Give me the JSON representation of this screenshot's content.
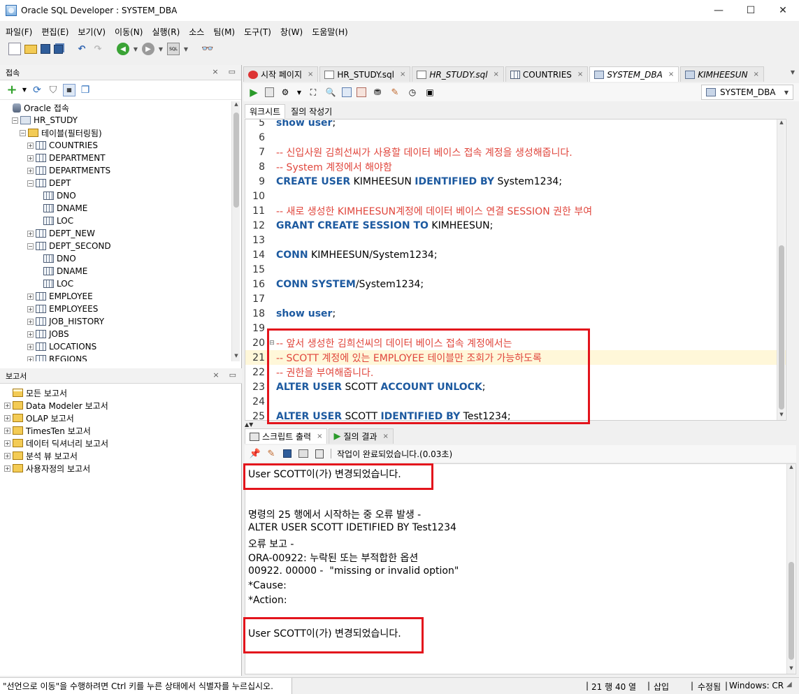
{
  "window": {
    "title": "Oracle SQL Developer : SYSTEM_DBA",
    "controls": {
      "minimize": "—",
      "maximize": "☐",
      "close": "✕"
    }
  },
  "menu": [
    "파일(F)",
    "편집(E)",
    "보기(V)",
    "이동(N)",
    "실행(R)",
    "소스",
    "팀(M)",
    "도구(T)",
    "창(W)",
    "도움말(H)"
  ],
  "connections_panel": {
    "title": "접속",
    "tree": [
      {
        "label": "Oracle 접속",
        "icon": "database-icon",
        "level": 0,
        "toggle": ""
      },
      {
        "label": "HR_STUDY",
        "icon": "connection-icon",
        "level": 1,
        "toggle": "-"
      },
      {
        "label": "테이블(필터링됨)",
        "icon": "folder-icon",
        "level": 2,
        "toggle": "-"
      },
      {
        "label": "COUNTRIES",
        "icon": "table-icon",
        "level": 3,
        "toggle": "+"
      },
      {
        "label": "DEPARTMENT",
        "icon": "table-icon",
        "level": 3,
        "toggle": "+"
      },
      {
        "label": "DEPARTMENTS",
        "icon": "table-icon",
        "level": 3,
        "toggle": "+"
      },
      {
        "label": "DEPT",
        "icon": "table-icon",
        "level": 3,
        "toggle": "-"
      },
      {
        "label": "DNO",
        "icon": "column-icon",
        "level": 4,
        "toggle": ""
      },
      {
        "label": "DNAME",
        "icon": "column-icon",
        "level": 4,
        "toggle": ""
      },
      {
        "label": "LOC",
        "icon": "column-icon",
        "level": 4,
        "toggle": ""
      },
      {
        "label": "DEPT_NEW",
        "icon": "table-icon",
        "level": 3,
        "toggle": "+"
      },
      {
        "label": "DEPT_SECOND",
        "icon": "table-icon",
        "level": 3,
        "toggle": "-"
      },
      {
        "label": "DNO",
        "icon": "column-icon",
        "level": 4,
        "toggle": ""
      },
      {
        "label": "DNAME",
        "icon": "column-icon",
        "level": 4,
        "toggle": ""
      },
      {
        "label": "LOC",
        "icon": "column-icon",
        "level": 4,
        "toggle": ""
      },
      {
        "label": "EMPLOYEE",
        "icon": "table-icon",
        "level": 3,
        "toggle": "+"
      },
      {
        "label": "EMPLOYEES",
        "icon": "table-icon",
        "level": 3,
        "toggle": "+"
      },
      {
        "label": "JOB_HISTORY",
        "icon": "table-icon",
        "level": 3,
        "toggle": "+"
      },
      {
        "label": "JOBS",
        "icon": "table-icon",
        "level": 3,
        "toggle": "+"
      },
      {
        "label": "LOCATIONS",
        "icon": "table-icon",
        "level": 3,
        "toggle": "+"
      },
      {
        "label": "REGIONS",
        "icon": "table-icon",
        "level": 3,
        "toggle": "+"
      }
    ]
  },
  "reports_panel": {
    "title": "보고서",
    "tree": [
      {
        "label": "모든 보고서",
        "icon": "reports-root-icon",
        "level": 0,
        "toggle": ""
      },
      {
        "label": "Data Modeler 보고서",
        "icon": "report-folder-icon",
        "level": 1,
        "toggle": "+"
      },
      {
        "label": "OLAP 보고서",
        "icon": "report-folder-icon",
        "level": 1,
        "toggle": "+"
      },
      {
        "label": "TimesTen 보고서",
        "icon": "report-folder-icon",
        "level": 1,
        "toggle": "+"
      },
      {
        "label": "데이터 딕셔너리 보고서",
        "icon": "report-folder-icon",
        "level": 1,
        "toggle": "+"
      },
      {
        "label": "분석 뷰 보고서",
        "icon": "report-folder-icon",
        "level": 1,
        "toggle": "+"
      },
      {
        "label": "사용자정의 보고서",
        "icon": "report-folder-icon",
        "level": 1,
        "toggle": "+"
      }
    ]
  },
  "doc_tabs": [
    {
      "label": "시작 페이지",
      "icon": "start-page-icon",
      "active": false,
      "italic": false
    },
    {
      "label": "HR_STUDY.sql",
      "icon": "sql-file-icon",
      "active": false,
      "italic": false
    },
    {
      "label": "HR_STUDY.sql",
      "icon": "sql-file-icon",
      "active": false,
      "italic": true
    },
    {
      "label": "COUNTRIES",
      "icon": "table-icon",
      "active": false,
      "italic": false
    },
    {
      "label": "SYSTEM_DBA",
      "icon": "connection-icon",
      "active": true,
      "italic": true
    },
    {
      "label": "KIMHEESUN",
      "icon": "connection-icon",
      "active": false,
      "italic": true
    }
  ],
  "connection_selector": {
    "value": "SYSTEM_DBA"
  },
  "worksheet_tabs": [
    "워크시트",
    "질의 작성기"
  ],
  "code_lines": [
    {
      "n": "5",
      "parts": [
        [
          "kw",
          "show user"
        ],
        [
          "plain",
          ";"
        ]
      ]
    },
    {
      "n": "6",
      "parts": []
    },
    {
      "n": "7",
      "parts": [
        [
          "cmt",
          "-- 신입사원 김희선씨가 사용할 데이터 베이스 접속 계정을 생성해줍니다."
        ]
      ]
    },
    {
      "n": "8",
      "parts": [
        [
          "cmt",
          "-- System 계정에서 해야함"
        ]
      ]
    },
    {
      "n": "9",
      "parts": [
        [
          "kw",
          "CREATE USER"
        ],
        [
          "plain",
          " KIMHEESUN "
        ],
        [
          "kw",
          "IDENTIFIED BY"
        ],
        [
          "plain",
          " System1234;"
        ]
      ]
    },
    {
      "n": "10",
      "parts": []
    },
    {
      "n": "11",
      "parts": [
        [
          "cmt",
          "-- 새로 생성한 KIMHEESUN계정에 데이터 베이스 연결 SESSION 권한 부여"
        ]
      ]
    },
    {
      "n": "12",
      "parts": [
        [
          "kw",
          "GRANT CREATE SESSION TO"
        ],
        [
          "plain",
          " KIMHEESUN;"
        ]
      ]
    },
    {
      "n": "13",
      "parts": []
    },
    {
      "n": "14",
      "parts": [
        [
          "kw",
          "CONN"
        ],
        [
          "plain",
          " KIMHEESUN/System1234;"
        ]
      ]
    },
    {
      "n": "15",
      "parts": []
    },
    {
      "n": "16",
      "parts": [
        [
          "kw",
          "CONN SYSTEM"
        ],
        [
          "plain",
          "/System1234;"
        ]
      ]
    },
    {
      "n": "17",
      "parts": []
    },
    {
      "n": "18",
      "parts": [
        [
          "kw",
          "show user"
        ],
        [
          "plain",
          ";"
        ]
      ]
    },
    {
      "n": "19",
      "parts": []
    },
    {
      "n": "20",
      "parts": [
        [
          "cmt",
          "-- 앞서 생성한 김희선씨의 데이터 베이스 접속 계정에서는"
        ]
      ],
      "fold": "⊟"
    },
    {
      "n": "21",
      "parts": [
        [
          "cmt",
          "-- SCOTT 계정에 있는 EMPLOYEE 테이블만 조회가 가능하도록"
        ]
      ],
      "highlight": true
    },
    {
      "n": "22",
      "parts": [
        [
          "cmt",
          "-- 권한을 부여해줍니다."
        ]
      ]
    },
    {
      "n": "23",
      "parts": [
        [
          "kw",
          "ALTER USER"
        ],
        [
          "plain",
          " SCOTT "
        ],
        [
          "kw",
          "ACCOUNT UNLOCK"
        ],
        [
          "plain",
          ";"
        ]
      ]
    },
    {
      "n": "24",
      "parts": []
    },
    {
      "n": "25",
      "parts": [
        [
          "kw",
          "ALTER USER"
        ],
        [
          "plain",
          " SCOTT "
        ],
        [
          "kw",
          "IDENTIFIED BY"
        ],
        [
          "plain",
          " Test1234;"
        ]
      ]
    }
  ],
  "output_tabs": [
    {
      "label": "스크립트 출력",
      "icon": "script-output-icon",
      "active": true
    },
    {
      "label": "질의 결과",
      "icon": "run-icon",
      "active": false
    }
  ],
  "output_status": "작업이 완료되었습니다.(0.03초)",
  "output_lines": [
    "User SCOTT이(가) 변경되었습니다.",
    "",
    "",
    "명령의 25 행에서 시작하는 중 오류 발생 -",
    "ALTER USER SCOTT IDETIFIED BY Test1234",
    "오류 보고 -",
    "ORA-00922: 누락된 또는 부적합한 옵션",
    "00922. 00000 -  \"missing or invalid option\"",
    "*Cause:",
    "*Action:",
    "",
    "User SCOTT이(가) 변경되었습니다."
  ],
  "status_bar": {
    "message": "\"선언으로 이동\"을 수행하려면 Ctrl 키를 누른 상태에서 식별자를 누르십시오.",
    "position": "21 행 40 열",
    "insert_mode": "삽입",
    "modified": "수정됨",
    "line_ending": "Windows: CR"
  }
}
